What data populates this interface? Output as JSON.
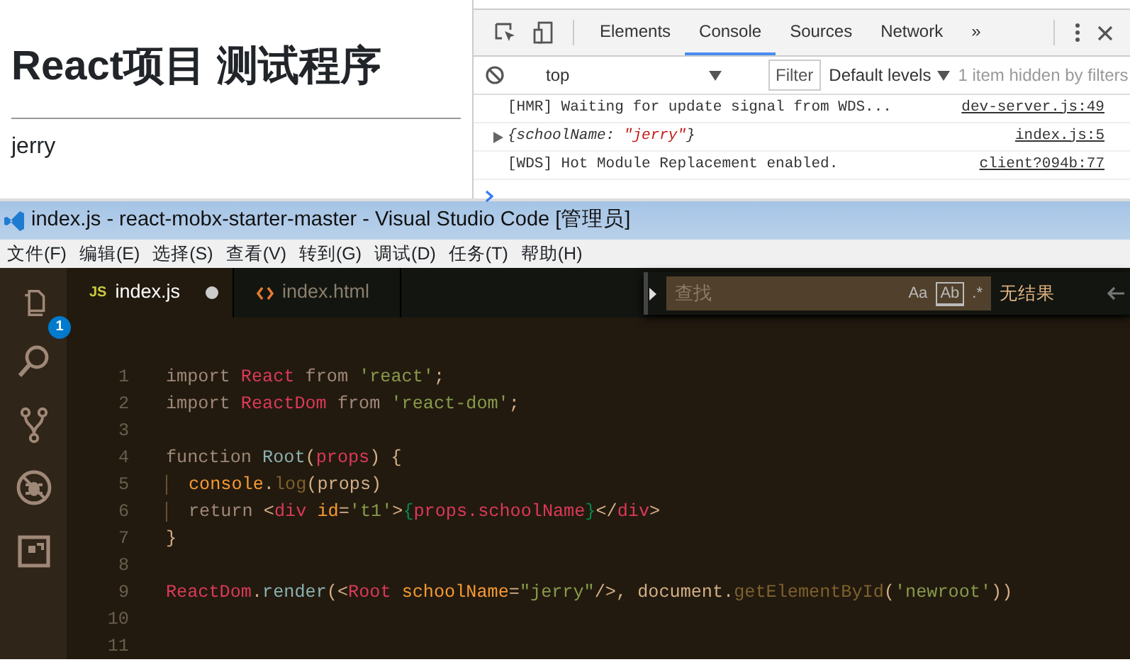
{
  "browser_page": {
    "heading": "React项目 测试程序",
    "content": "jerry"
  },
  "devtools": {
    "tabs": [
      {
        "label": "Elements",
        "selected": false
      },
      {
        "label": "Console",
        "selected": true
      },
      {
        "label": "Sources",
        "selected": false
      },
      {
        "label": "Network",
        "selected": false
      }
    ],
    "more_tabs": "»",
    "context": "top",
    "filter": "Filter",
    "levels": "Default levels",
    "hidden_note": "1 item hidden by filters",
    "entries": [
      {
        "kind": "text",
        "expandable": false,
        "message": [
          {
            "kind": "plain",
            "text": "[HMR] Waiting for update signal from WDS..."
          }
        ],
        "source": "dev-server.js:49"
      },
      {
        "kind": "object",
        "expandable": true,
        "message": [
          {
            "kind": "plain",
            "text": "{schoolName: "
          },
          {
            "kind": "string",
            "text": "\"jerry\""
          },
          {
            "kind": "plain",
            "text": "}"
          }
        ],
        "source": "index.js:5"
      },
      {
        "kind": "text",
        "expandable": false,
        "message": [
          {
            "kind": "plain",
            "text": "[WDS] Hot Module Replacement enabled."
          }
        ],
        "source": "client?094b:77"
      }
    ]
  },
  "editor": {
    "window": {
      "title": "index.js - react-mobx-starter-master - Visual Studio Code [管理员]"
    },
    "menu": [
      "文件(F)",
      "编辑(E)",
      "选择(S)",
      "查看(V)",
      "转到(G)",
      "调试(D)",
      "任务(T)",
      "帮助(H)"
    ],
    "activity_bar": [
      {
        "kind": "files",
        "badge": "1"
      },
      {
        "kind": "search"
      },
      {
        "kind": "scm"
      },
      {
        "kind": "debug"
      },
      {
        "kind": "extensions"
      }
    ],
    "tabs": [
      {
        "label": "index.js",
        "kind": "js",
        "type_text": "JS",
        "selected": true,
        "dirty": true
      },
      {
        "label": "index.html",
        "kind": "html",
        "selected": false,
        "dirty": false
      }
    ],
    "find": {
      "placeholder": "查找",
      "options": [
        {
          "kind": "case",
          "label": "Aa"
        },
        {
          "kind": "word",
          "label": "Ab"
        },
        {
          "kind": "regex",
          "label": ".*"
        }
      ],
      "result": "无结果"
    },
    "lines": [
      {
        "number": "1",
        "tokens": [
          {
            "kind": "keyword",
            "text": "import "
          },
          {
            "kind": "variable",
            "text": "React "
          },
          {
            "kind": "keyword",
            "text": "from "
          },
          {
            "kind": "string",
            "text": "'react'"
          },
          {
            "kind": "plain",
            "text": ";"
          }
        ]
      },
      {
        "number": "2",
        "tokens": [
          {
            "kind": "keyword",
            "text": "import "
          },
          {
            "kind": "variable",
            "text": "ReactDom "
          },
          {
            "kind": "keyword",
            "text": "from "
          },
          {
            "kind": "string",
            "text": "'react-dom'"
          },
          {
            "kind": "plain",
            "text": ";"
          }
        ]
      },
      {
        "number": "3"
      },
      {
        "number": "4",
        "tokens": [
          {
            "kind": "keyword",
            "text": "function "
          },
          {
            "kind": "function",
            "text": "Root"
          },
          {
            "kind": "plain",
            "text": "("
          },
          {
            "kind": "variable",
            "text": "props"
          },
          {
            "kind": "plain",
            "text": ") {"
          }
        ]
      },
      {
        "number": "5",
        "indent": true,
        "tokens": [
          {
            "kind": "builtin",
            "text": "console"
          },
          {
            "kind": "plain",
            "text": "."
          },
          {
            "kind": "method",
            "text": "log"
          },
          {
            "kind": "plain",
            "text": "(props)"
          }
        ]
      },
      {
        "number": "6",
        "indent": true,
        "tokens": [
          {
            "kind": "keyword",
            "text": "return "
          },
          {
            "kind": "plain",
            "text": "<"
          },
          {
            "kind": "tag",
            "text": "div "
          },
          {
            "kind": "attr",
            "text": "id"
          },
          {
            "kind": "plain",
            "text": "="
          },
          {
            "kind": "string",
            "text": "'t1'"
          },
          {
            "kind": "plain",
            "text": ">"
          },
          {
            "kind": "brace",
            "text": "{"
          },
          {
            "kind": "variable",
            "text": "props.schoolName"
          },
          {
            "kind": "brace",
            "text": "}"
          },
          {
            "kind": "plain",
            "text": "</"
          },
          {
            "kind": "tag",
            "text": "div"
          },
          {
            "kind": "plain",
            "text": ">"
          }
        ]
      },
      {
        "number": "7",
        "tokens": [
          {
            "kind": "plain",
            "text": "}"
          }
        ]
      },
      {
        "number": "8"
      },
      {
        "number": "9",
        "tokens": [
          {
            "kind": "variable",
            "text": "ReactDom"
          },
          {
            "kind": "plain",
            "text": "."
          },
          {
            "kind": "function",
            "text": "render"
          },
          {
            "kind": "plain",
            "text": "(<"
          },
          {
            "kind": "tag",
            "text": "Root "
          },
          {
            "kind": "attr",
            "text": "schoolName"
          },
          {
            "kind": "plain",
            "text": "="
          },
          {
            "kind": "string",
            "text": "\"jerry\""
          },
          {
            "kind": "plain",
            "text": "/>, document."
          },
          {
            "kind": "method",
            "text": "getElementById"
          },
          {
            "kind": "plain",
            "text": "("
          },
          {
            "kind": "string",
            "text": "'newroot'"
          },
          {
            "kind": "plain",
            "text": "))"
          }
        ]
      },
      {
        "number": "10"
      },
      {
        "number": "11"
      }
    ]
  }
}
